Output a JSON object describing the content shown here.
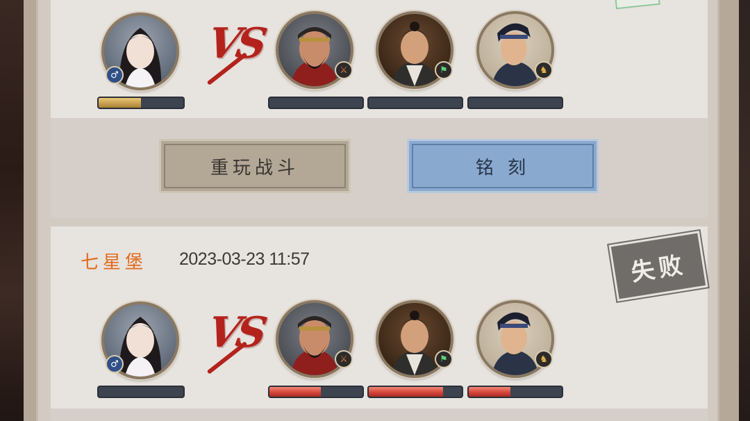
{
  "colors": {
    "vs_red": "#b3231c",
    "location_orange": "#e26a1d",
    "hp_gold": "#c9a051",
    "hp_red": "#d6463a",
    "button_replay_bg": "#b3a796",
    "button_engrave_bg": "#89a9cf",
    "stamp_gray": "#6f6c69"
  },
  "battles": [
    {
      "vs_label": "VS",
      "player": {
        "badge_icon": "male-symbol-icon",
        "badge_glyph": "♂",
        "hp_fraction": 0.5
      },
      "enemies": [
        {
          "badge_icon": "sword-icon",
          "badge_glyph": "⚔",
          "hp_fraction": 0.0
        },
        {
          "badge_icon": "flag-icon",
          "badge_glyph": "⚑",
          "hp_fraction": 0.0
        },
        {
          "badge_icon": "horse-icon",
          "badge_glyph": "♞",
          "hp_fraction": 0.0
        }
      ],
      "actions": {
        "replay_label": "重玩战斗",
        "engrave_label": "铭 刻"
      }
    },
    {
      "location": "七星堡",
      "datetime": "2023-03-23 11:57",
      "result": "失败",
      "vs_label": "VS",
      "player": {
        "badge_icon": "male-symbol-icon",
        "badge_glyph": "♂",
        "hp_fraction": 0.0
      },
      "enemies": [
        {
          "badge_icon": "sword-icon",
          "badge_glyph": "⚔",
          "hp_fraction": 0.55
        },
        {
          "badge_icon": "flag-icon",
          "badge_glyph": "⚑",
          "hp_fraction": 0.8
        },
        {
          "badge_icon": "horse-icon",
          "badge_glyph": "♞",
          "hp_fraction": 0.45
        }
      ]
    }
  ]
}
